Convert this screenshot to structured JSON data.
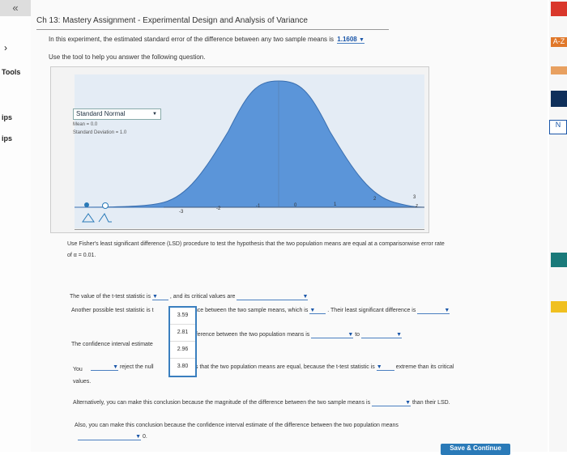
{
  "rail": {
    "top_icon": "«",
    "chevron": "›",
    "tools": "Tools",
    "tips1": "ips",
    "tips2": "ips"
  },
  "right_rail": {
    "az": "A-Z",
    "n": "N"
  },
  "assignment": {
    "title": "Ch 13: Mastery Assignment - Experimental Design and Analysis of Variance",
    "sentence1": "In this experiment, the estimated standard error of the difference between any two sample means is",
    "std_error_value": "1.1608",
    "sentence2": "Use the tool to help you answer the following question."
  },
  "tool": {
    "distribution": "Standard Normal",
    "mean_label": "Mean = 0.0",
    "sd_label": "Standard Deviation = 1.0",
    "x_ticks": [
      "-3",
      "-2",
      "-1",
      "0",
      "1",
      "2",
      "3"
    ],
    "axis_var": "z",
    "icon": "distribution-tool-icon"
  },
  "question": {
    "intro": "Use Fisher's least significant difference (LSD) procedure to test the hypothesis that the two population means are equal at a comparisonwise error rate",
    "alpha": "of α = 0.01.",
    "l1a": "The value of the t-test statistic is",
    "l1b": ", and its critical values are",
    "l2a": "Another possible test statistic is t",
    "l2b": "ence between the two sample means, which is",
    "l2c": ". Their least significant difference is",
    "l3a": "The confidence interval estimate",
    "l3b": "fference between the two population means is",
    "l3c": "to",
    "l4a": "You",
    "l4b": "reject the null",
    "l4c": "s that the two population means are equal, because the t-test statistic is",
    "l4d": "extreme than its critical",
    "l4e": "values.",
    "l5a": "Alternatively, you can make this conclusion because the magnitude of the difference between the two sample means is",
    "l5b": "than their LSD.",
    "l6a": "Also, you can make this conclusion because the confidence interval estimate of the difference between the two population means",
    "l6b": "0."
  },
  "dropdown_options": [
    "3.59",
    "2.81",
    "2.96",
    "3.80"
  ],
  "footer": {
    "continue": "Save & Continue"
  }
}
